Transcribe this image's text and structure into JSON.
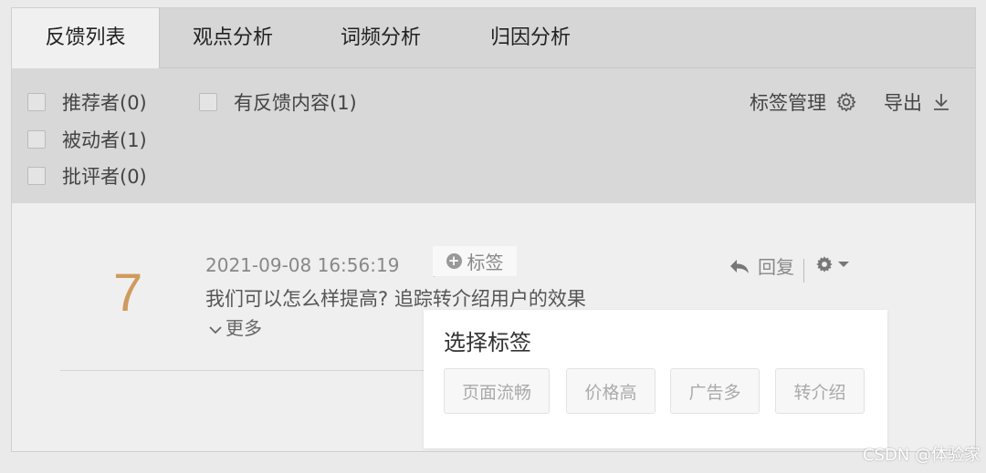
{
  "tabs": [
    {
      "label": "反馈列表",
      "active": true
    },
    {
      "label": "观点分析"
    },
    {
      "label": "词频分析"
    },
    {
      "label": "归因分析"
    }
  ],
  "filters": {
    "promoters": "推荐者(0)",
    "passives": "被动者(1)",
    "detractors": "批评者(0)",
    "has_feedback": "有反馈内容(1)"
  },
  "toolbar": {
    "tag_manage": "标签管理",
    "export": "导出"
  },
  "item": {
    "score": "7",
    "timestamp": "2021-09-08 16:56:19",
    "add_tag": "标签",
    "reply": "回复",
    "content": "我们可以怎么样提高? 追踪转介绍用户的效果",
    "more": "更多"
  },
  "popup": {
    "title": "选择标签",
    "tags": [
      "页面流畅",
      "价格高",
      "广告多",
      "转介绍"
    ]
  },
  "watermark": "CSDN @体验家",
  "colors": {
    "score": "#d09a5e",
    "popup_bg": "#ffffff"
  }
}
